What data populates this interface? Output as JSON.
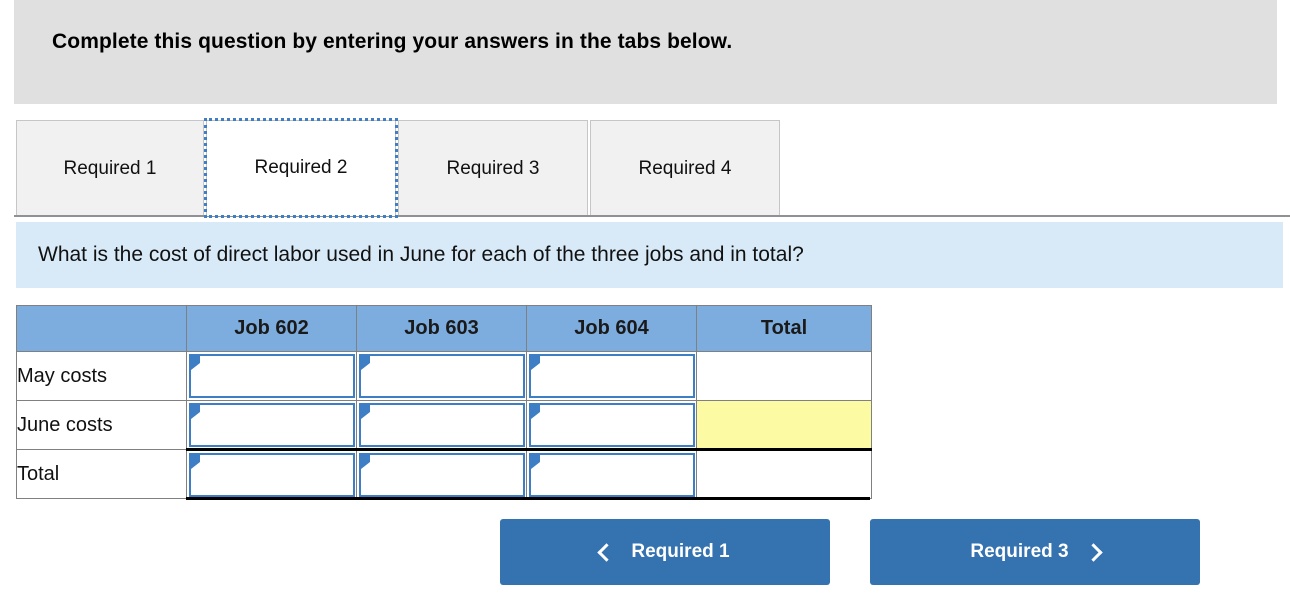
{
  "instruction": {
    "text": "Complete this question by entering your answers in the tabs below."
  },
  "tabs": {
    "items": [
      {
        "label": "Required 1",
        "active": false
      },
      {
        "label": "Required 2",
        "active": true
      },
      {
        "label": "Required 3",
        "active": false
      },
      {
        "label": "Required 4",
        "active": false
      }
    ]
  },
  "question": {
    "text": "What is the cost of direct labor used in June for each of the three jobs and in total?"
  },
  "table": {
    "headers": [
      "",
      "Job 602",
      "Job 603",
      "Job 604",
      "Total"
    ],
    "rows": [
      {
        "label": "May costs",
        "cells": [
          {
            "value": "",
            "editable": true,
            "highlight": false
          },
          {
            "value": "",
            "editable": true,
            "highlight": false
          },
          {
            "value": "",
            "editable": true,
            "highlight": false
          },
          {
            "value": "",
            "editable": false,
            "highlight": false
          }
        ]
      },
      {
        "label": "June costs",
        "cells": [
          {
            "value": "",
            "editable": true,
            "highlight": false
          },
          {
            "value": "",
            "editable": true,
            "highlight": false
          },
          {
            "value": "",
            "editable": true,
            "highlight": false
          },
          {
            "value": "",
            "editable": false,
            "highlight": true
          }
        ]
      },
      {
        "label": "Total",
        "cells": [
          {
            "value": "",
            "editable": true,
            "highlight": false
          },
          {
            "value": "",
            "editable": true,
            "highlight": false
          },
          {
            "value": "",
            "editable": true,
            "highlight": false
          },
          {
            "value": "",
            "editable": false,
            "highlight": false
          }
        ]
      }
    ]
  },
  "navigation": {
    "prev_label": "Required 1",
    "next_label": "Required 3",
    "prev_icon": "chevron-left-icon",
    "next_icon": "chevron-right-icon"
  },
  "colors": {
    "banner_gray": "#e0e0e0",
    "question_blue": "#d8eaf8",
    "table_header_blue": "#7dadde",
    "highlight_yellow": "#fdfaa4",
    "button_blue": "#3572b0",
    "input_border_blue": "#3d7ec4"
  }
}
